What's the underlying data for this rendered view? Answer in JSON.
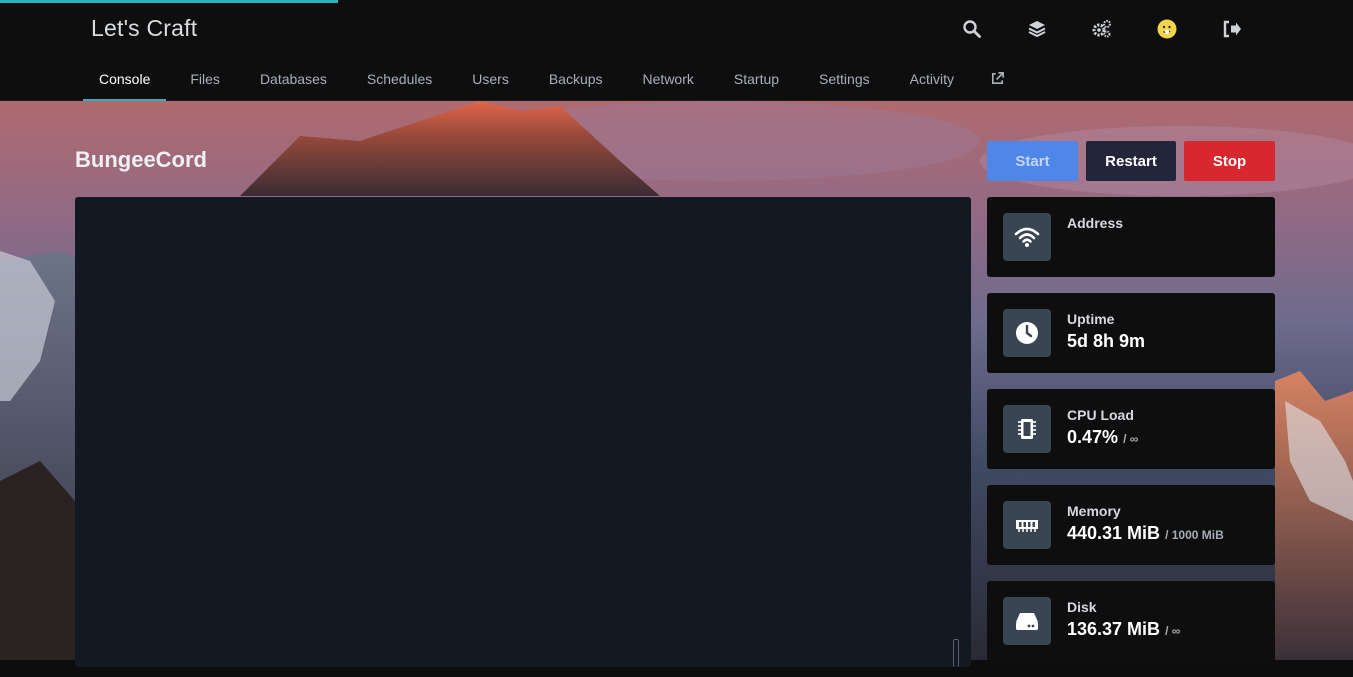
{
  "app": {
    "title": "Let's Craft"
  },
  "header_icons": [
    "search-icon",
    "layers-icon",
    "cogs-icon",
    "avatar",
    "sign-out-icon"
  ],
  "tabs": [
    {
      "label": "Console",
      "active": true
    },
    {
      "label": "Files"
    },
    {
      "label": "Databases"
    },
    {
      "label": "Schedules"
    },
    {
      "label": "Users"
    },
    {
      "label": "Backups"
    },
    {
      "label": "Network"
    },
    {
      "label": "Startup"
    },
    {
      "label": "Settings"
    },
    {
      "label": "Activity"
    }
  ],
  "external_link_icon": "external-link-icon",
  "server": {
    "name": "BungeeCord"
  },
  "power": {
    "start": "Start",
    "restart": "Restart",
    "stop": "Stop"
  },
  "stats": {
    "address": {
      "label": "Address",
      "value": "",
      "icon": "wifi-icon"
    },
    "uptime": {
      "label": "Uptime",
      "value": "5d 8h 9m",
      "icon": "clock-icon"
    },
    "cpu": {
      "label": "CPU Load",
      "value": "0.47%",
      "limit": "/ ∞",
      "icon": "microchip-icon"
    },
    "memory": {
      "label": "Memory",
      "value": "440.31 MiB",
      "limit": "/ 1000 MiB",
      "icon": "memory-icon"
    },
    "disk": {
      "label": "Disk",
      "value": "136.37 MiB",
      "limit": "/ ∞",
      "icon": "hdd-icon"
    }
  },
  "colors": {
    "accent": "#2bb3c0",
    "start": "#4f86e8",
    "restart": "#23253a",
    "stop": "#d9272e"
  }
}
